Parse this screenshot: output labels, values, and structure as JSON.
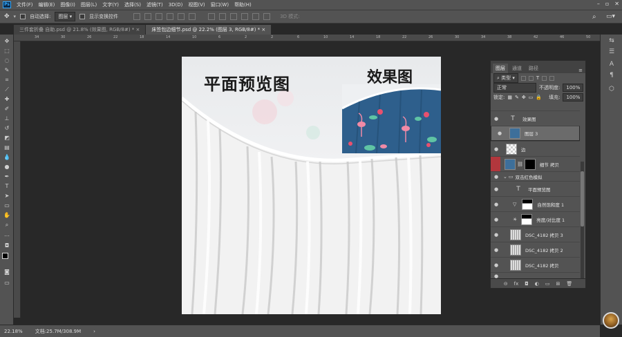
{
  "app": {
    "logo": "Ps"
  },
  "menu": [
    "文件(F)",
    "编辑(E)",
    "图像(I)",
    "图层(L)",
    "文字(Y)",
    "选择(S)",
    "滤镜(T)",
    "3D(D)",
    "视图(V)",
    "窗口(W)",
    "帮助(H)"
  ],
  "options": {
    "auto_select_label": "自动选择:",
    "auto_select_value": "图层",
    "show_transform_label": "显示变换控件",
    "mode_3d": "3D 模式:"
  },
  "tabs": [
    {
      "label": "三件套折叠 自助.psd @ 21.8% (效果图, RGB/8#) *",
      "active": false
    },
    {
      "label": "床笠包边细节.psd @ 22.2% (图层 3, RGB/8#) *",
      "active": true
    }
  ],
  "ruler": [
    "34",
    "30",
    "26",
    "22",
    "18",
    "14",
    "10",
    "6",
    "2",
    "2",
    "6",
    "10",
    "14",
    "18",
    "22",
    "26",
    "30",
    "34",
    "38",
    "42",
    "46",
    "50"
  ],
  "canvas": {
    "title_left": "平面预览图",
    "title_right": "效果图"
  },
  "status": {
    "zoom": "22.18%",
    "doc": "文档:25.7M/308.9M"
  },
  "layers_panel": {
    "tabs": [
      "图层",
      "通道",
      "路径"
    ],
    "filter_label": "类型",
    "blend_mode": "正常",
    "opacity_label": "不透明度:",
    "opacity_value": "100%",
    "lock_label": "锁定:",
    "fill_label": "填充:",
    "fill_value": "100%",
    "layers": [
      {
        "name": "效果图",
        "kind": "text",
        "selected": false
      },
      {
        "name": "图层 3",
        "kind": "pixel",
        "selected": true
      },
      {
        "name": "边",
        "kind": "pixel",
        "selected": false
      },
      {
        "name": "细节 拷贝",
        "kind": "masked",
        "selected": false
      },
      {
        "name": "双击红色模拟",
        "kind": "group",
        "selected": false
      },
      {
        "name": "平面预览图",
        "kind": "text",
        "selected": false
      },
      {
        "name": "自然饱和度 1",
        "kind": "adjust",
        "selected": false
      },
      {
        "name": "亮度/对比度 1",
        "kind": "adjust",
        "selected": false
      },
      {
        "name": "DSC_4182 拷贝 3",
        "kind": "photo",
        "selected": false
      },
      {
        "name": "DSC_4182 拷贝 2",
        "kind": "photo",
        "selected": false
      },
      {
        "name": "DSC_4182 拷贝",
        "kind": "photo",
        "selected": false
      }
    ]
  },
  "colors": {
    "ui": "#535353",
    "pasteboard": "#282828",
    "selected_layer": "#6b6b6b",
    "fabric_blue": "#2e5f8c"
  }
}
